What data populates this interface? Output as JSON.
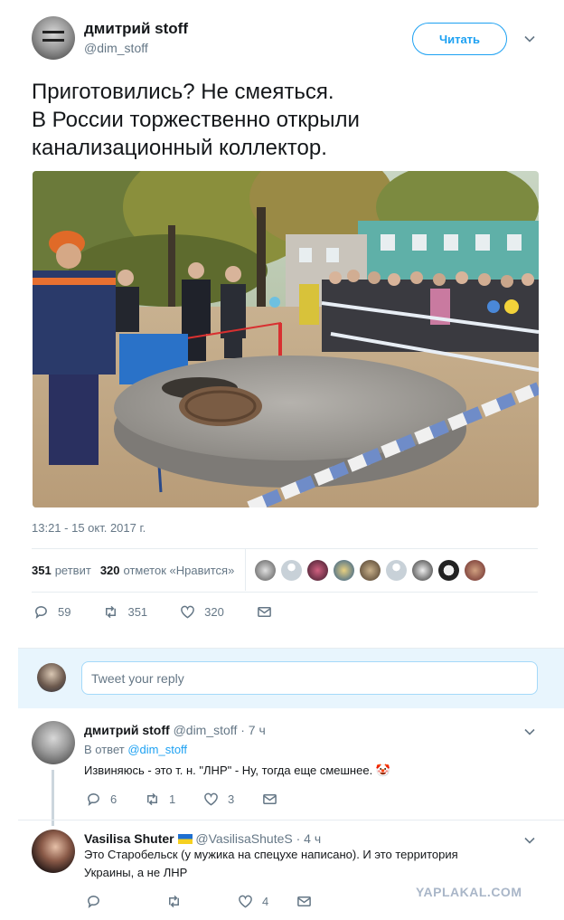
{
  "tweet": {
    "display_name": "дмитрий stoff",
    "handle": "@dim_stoff",
    "follow_label": "Читать",
    "text": "Приготовились? Не смеяться.\nВ России торжественно открыли канализационный коллектор.",
    "timestamp": "13:21 - 15 окт. 2017 г.",
    "retweets_count": "351",
    "retweets_label": "ретвит",
    "likes_count": "320",
    "likes_label": "отметок «Нравится»",
    "actions": {
      "replies": "59",
      "retweets": "351",
      "likes": "320"
    }
  },
  "reply_box": {
    "placeholder": "Tweet your reply"
  },
  "replies": [
    {
      "display_name": "дмитрий stoff",
      "handle": "@dim_stoff",
      "age": "· 7 ч",
      "reply_to_prefix": "В ответ",
      "reply_to_handle": "@dim_stoff",
      "text": "Извиняюсь - это т. н. \"ЛНР\" - Ну, тогда еще смешнее. 🤡",
      "actions": {
        "replies": "6",
        "retweets": "1",
        "likes": "3"
      }
    },
    {
      "display_name": "Vasilisa Shuter",
      "handle": "@VasilisaShuteS",
      "age": "· 4 ч",
      "text": "Это Старобельск (у мужика на спецухе написано). И это территория Украины, а не ЛНР",
      "actions": {
        "replies": "",
        "retweets": "",
        "likes": "4"
      }
    }
  ],
  "watermark": "YAPLAKAL.COM",
  "colors": {
    "accent": "#1da1f2",
    "muted": "#657786",
    "divider": "#e6ecf0",
    "reply_bg": "#e8f5fd"
  },
  "icons": [
    "caret-down-icon",
    "reply-icon",
    "retweet-icon",
    "heart-icon",
    "message-icon",
    "flag-ukraine-icon"
  ]
}
